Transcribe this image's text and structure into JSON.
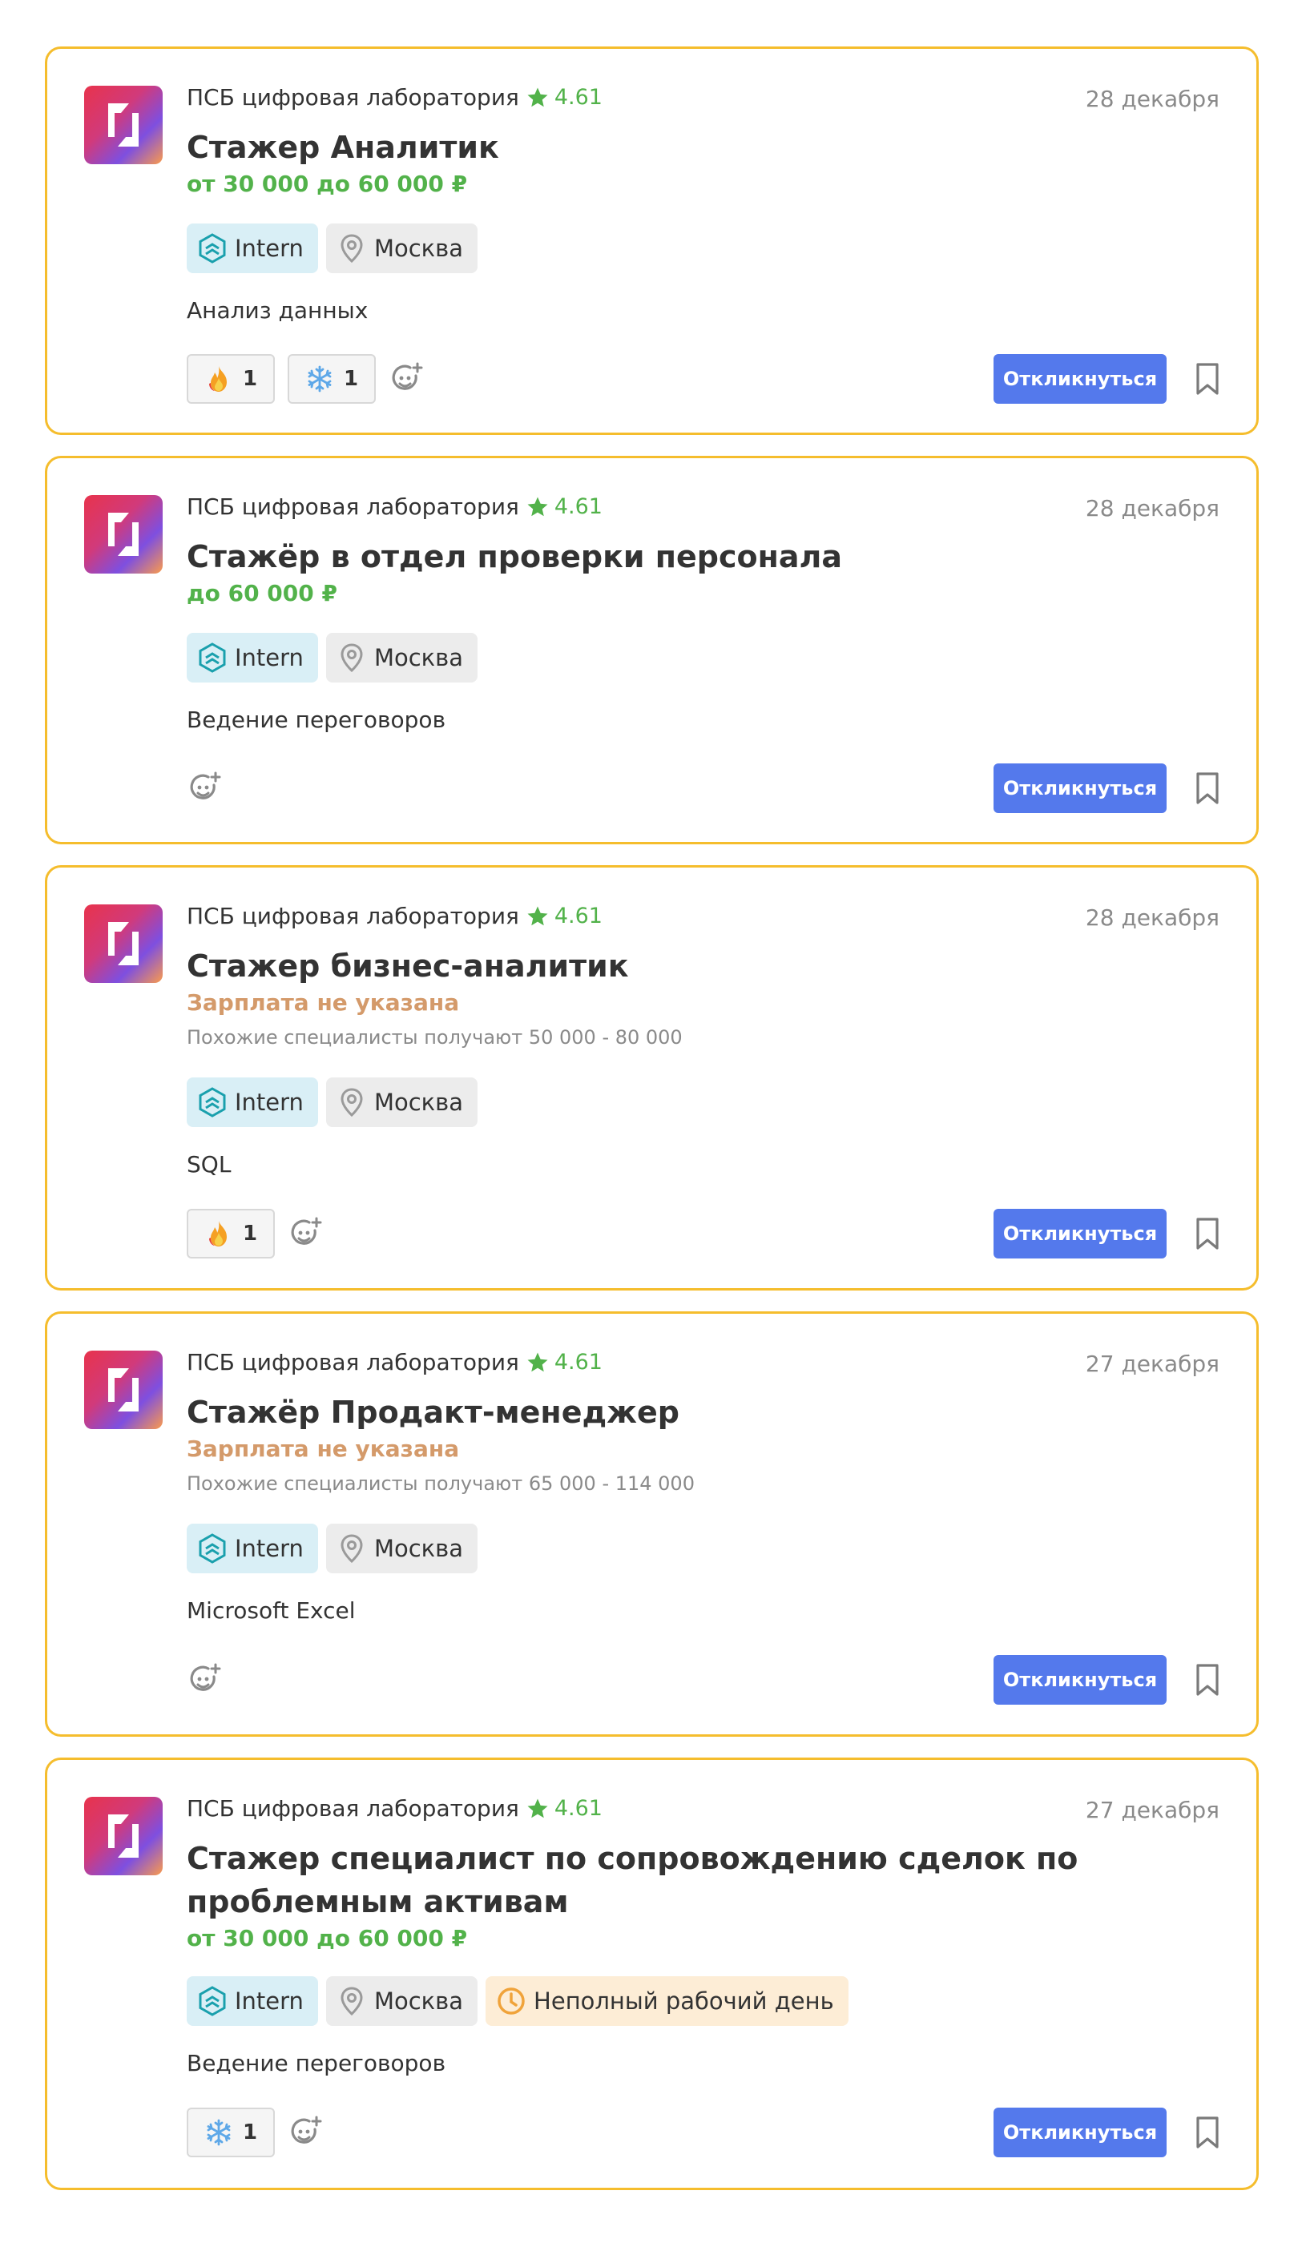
{
  "colors": {
    "card_border": "#f5bd2d",
    "accent_green": "#52b24a",
    "salary_unknown": "#d49a6a",
    "button": "#5479ec",
    "intern_tag_bg": "#d9eff6",
    "city_tag_bg": "#ececec",
    "parttime_tag_bg": "#fdedd6"
  },
  "vacancies": [
    {
      "company": "ПСБ цифровая лаборатория",
      "rating": "4.61",
      "date": "28 декабря",
      "title": "Стажер Аналитик",
      "salary": "от 30 000 до 60 000 ₽",
      "tags": {
        "level": "Intern",
        "city": "Москва"
      },
      "skill": "Анализ данных",
      "reactions": [
        {
          "icon": "fire-icon",
          "count": "1"
        },
        {
          "icon": "snowflake-icon",
          "count": "1"
        }
      ],
      "apply_label": "Откликнуться"
    },
    {
      "company": "ПСБ цифровая лаборатория",
      "rating": "4.61",
      "date": "28 декабря",
      "title": "Стажёр в отдел проверки персонала",
      "salary": "до 60 000 ₽",
      "tags": {
        "level": "Intern",
        "city": "Москва"
      },
      "skill": "Ведение переговоров",
      "reactions": [],
      "apply_label": "Откликнуться"
    },
    {
      "company": "ПСБ цифровая лаборатория",
      "rating": "4.61",
      "date": "28 декабря",
      "title": "Стажер бизнес-аналитик",
      "salary": "Зарплата не указана",
      "similar": "Похожие специалисты получают 50 000 - 80 000",
      "tags": {
        "level": "Intern",
        "city": "Москва"
      },
      "skill": "SQL",
      "reactions": [
        {
          "icon": "fire-icon",
          "count": "1"
        }
      ],
      "apply_label": "Откликнуться"
    },
    {
      "company": "ПСБ цифровая лаборатория",
      "rating": "4.61",
      "date": "27 декабря",
      "title": "Стажёр Продакт-менеджер",
      "salary": "Зарплата не указана",
      "similar": "Похожие специалисты получают 65 000 - 114 000",
      "tags": {
        "level": "Intern",
        "city": "Москва"
      },
      "skill": "Microsoft Excel",
      "reactions": [],
      "apply_label": "Откликнуться"
    },
    {
      "company": "ПСБ цифровая лаборатория",
      "rating": "4.61",
      "date": "27 декабря",
      "title": "Стажер специалист по сопровождению сделок по проблемным активам",
      "salary": "от 30 000 до 60 000 ₽",
      "tags": {
        "level": "Intern",
        "city": "Москва",
        "schedule": "Неполный рабочий день"
      },
      "skill": "Ведение переговоров",
      "reactions": [
        {
          "icon": "snowflake-icon",
          "count": "1"
        }
      ],
      "apply_label": "Откликнуться"
    }
  ]
}
